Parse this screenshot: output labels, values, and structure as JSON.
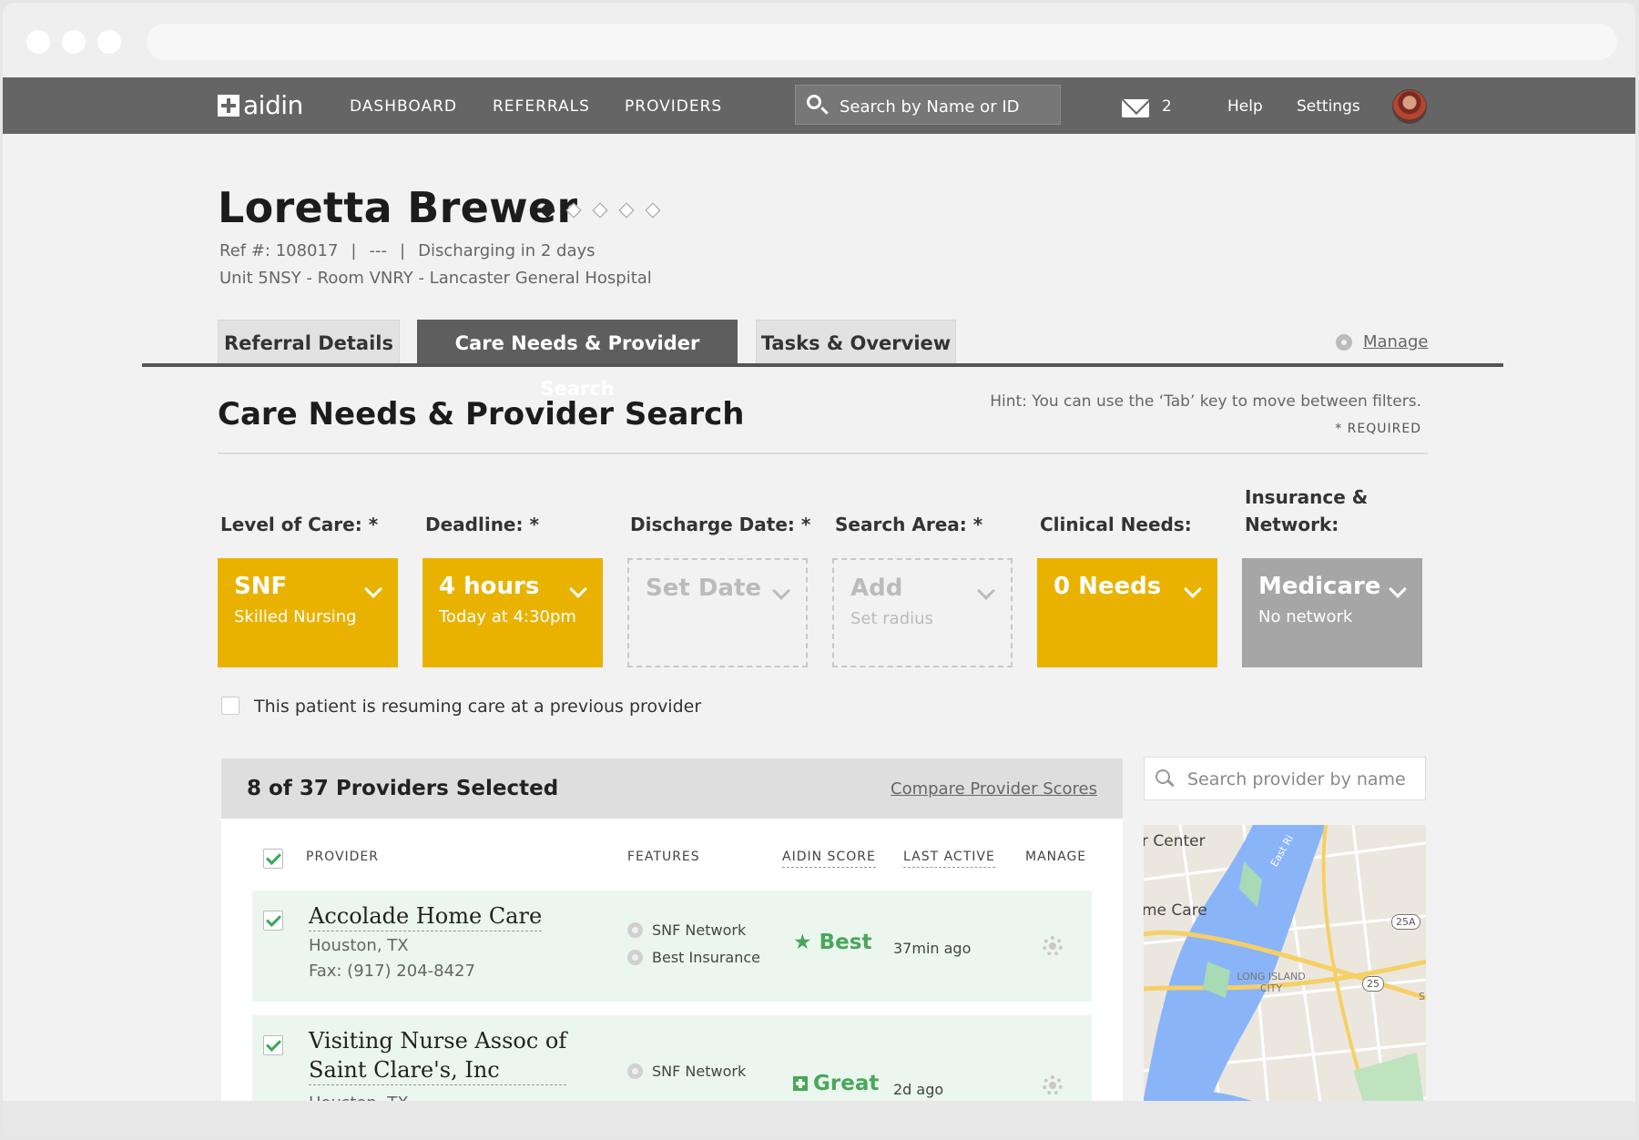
{
  "nav": {
    "logo_text": "aidin",
    "links": [
      "DASHBOARD",
      "REFERRALS",
      "PROVIDERS"
    ],
    "search_placeholder": "Search by Name or ID",
    "mail_count": "2",
    "help": "Help",
    "settings": "Settings"
  },
  "patient": {
    "name": "Loretta Brewer",
    "ref": "Ref #: 108017",
    "separator": "|",
    "placeholder": "---",
    "discharging": "Discharging in 2 days",
    "location": "Unit 5NSY - Room VNRY - Lancaster General Hospital",
    "progress_steps_total": 5,
    "progress_steps_done": 1
  },
  "tabs": [
    "Referral Details",
    "Care Needs & Provider Search",
    "Tasks & Overview"
  ],
  "manage_label": "Manage",
  "section": {
    "title": "Care Needs & Provider Search",
    "hint": "Hint: You can use the ‘Tab’ key to move between filters.",
    "required": "* REQUIRED"
  },
  "filters": [
    {
      "label": "Level of Care: *",
      "value": "SNF",
      "sub": "Skilled Nursing",
      "style": "yellow"
    },
    {
      "label": "Deadline: *",
      "value": "4 hours",
      "sub": "Today at 4:30pm",
      "style": "yellow"
    },
    {
      "label": "Discharge Date: *",
      "value": "Set Date",
      "sub": "",
      "style": "empty"
    },
    {
      "label": "Search Area: *",
      "value": "Add",
      "sub": "Set radius",
      "style": "empty"
    },
    {
      "label": "Clinical Needs:",
      "value": "0 Needs",
      "sub": "",
      "style": "yellow"
    },
    {
      "label_line1": "Insurance &",
      "label_line2": "Network:",
      "value": "Medicare",
      "sub": "No network",
      "style": "gray"
    }
  ],
  "colors": {
    "yellow": "#e9b200",
    "gray": "#a6a6a6",
    "nav": "#656565",
    "green": "#4aa65a"
  },
  "resume_label": "This patient is resuming care at a previous provider",
  "providers_panel": {
    "title": "8 of 37 Providers Selected",
    "compare": "Compare Provider Scores",
    "columns": [
      "PROVIDER",
      "FEATURES",
      "AIDIN SCORE",
      "LAST ACTIVE",
      "MANAGE"
    ],
    "rows": [
      {
        "name": "Accolade Home Care",
        "city": "Houston, TX",
        "fax": "Fax: (917) 204-8427",
        "features": [
          "SNF Network",
          "Best Insurance"
        ],
        "score": "Best",
        "score_icon": "star-icon",
        "last_active": "37min ago"
      },
      {
        "name_line1": "Visiting Nurse Assoc of",
        "name_line2": "Saint Clare's, Inc",
        "city": "Houston, TX",
        "features": [
          "SNF Network"
        ],
        "score": "Great",
        "score_icon": "plus-square-icon",
        "last_active": "2d ago"
      }
    ]
  },
  "side": {
    "search_placeholder": "Search provider by name",
    "map_labels": [
      "r Center",
      "me Care",
      "East Ri",
      "LONG ISLAND CITY",
      "25A",
      "25",
      "S"
    ]
  }
}
